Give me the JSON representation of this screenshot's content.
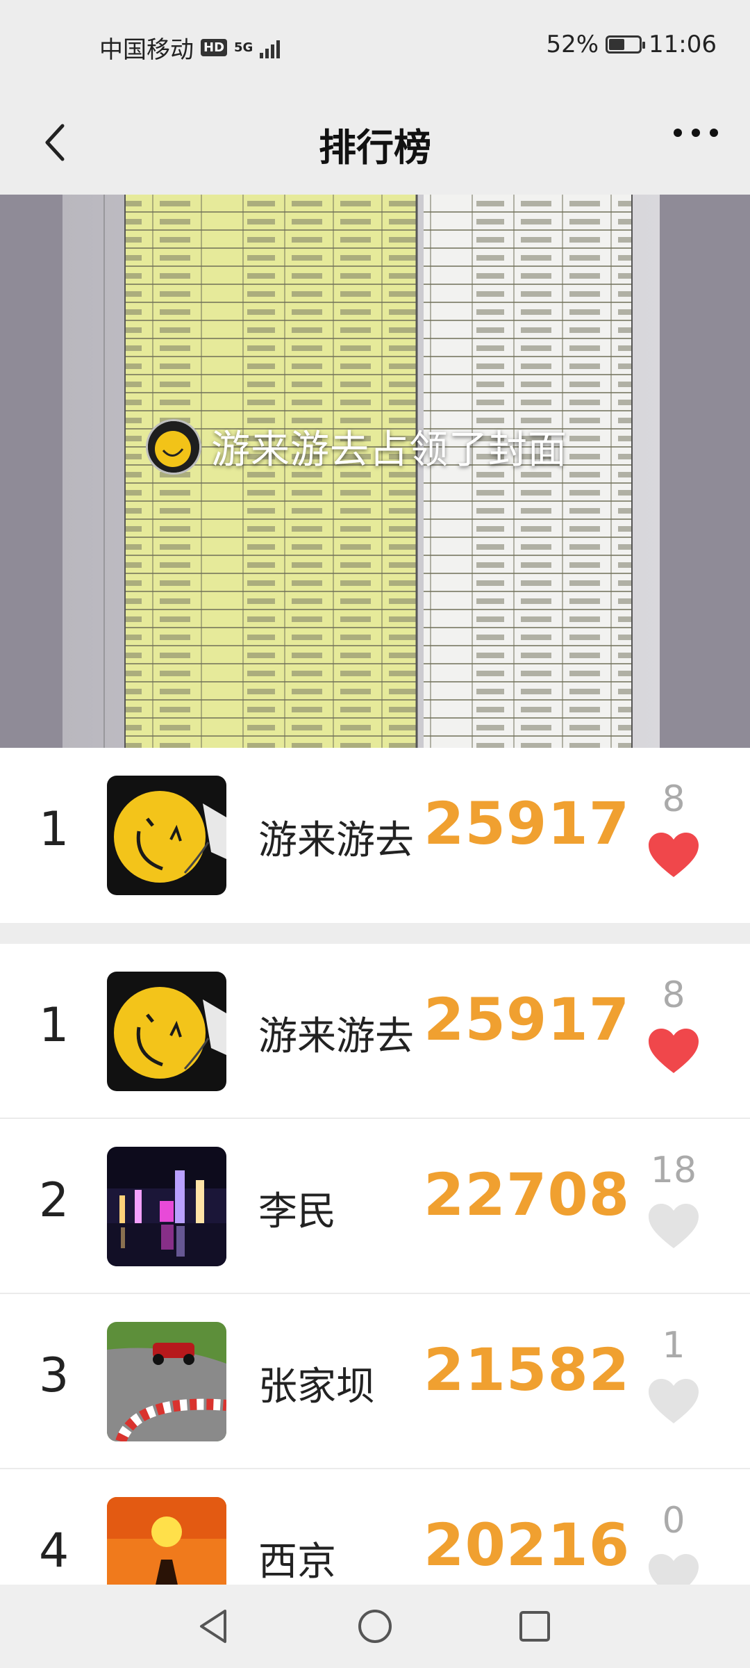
{
  "status_bar": {
    "carrier": "中国移动",
    "hd": "HD",
    "network": "5G",
    "battery_percent": "52%",
    "battery_level": 0.52,
    "time": "11:06"
  },
  "header": {
    "title": "排行榜",
    "back_icon": "chevron-left-icon",
    "more_icon": "more-horizontal-icon"
  },
  "cover": {
    "banner_text": "游来游去占领了封面"
  },
  "my_rank": {
    "rank": "1",
    "name": "游来游去",
    "steps": "25917",
    "likes": "8",
    "liked": true
  },
  "ranking": [
    {
      "rank": "1",
      "name": "游来游去",
      "steps": "25917",
      "likes": "8",
      "liked": true
    },
    {
      "rank": "2",
      "name": "李民",
      "steps": "22708",
      "likes": "18",
      "liked": false
    },
    {
      "rank": "3",
      "name": "张家坝",
      "steps": "21582",
      "likes": "1",
      "liked": false
    },
    {
      "rank": "4",
      "name": "西京",
      "steps": "20216",
      "likes": "0",
      "liked": false
    }
  ],
  "colors": {
    "steps": "#f0a030",
    "heart_liked": "#f0474b",
    "heart_unliked": "#e3e3e3",
    "background_gray": "#ededed"
  },
  "nav_bar": {
    "back": "triangle-back-icon",
    "home": "circle-home-icon",
    "recents": "square-recents-icon"
  }
}
